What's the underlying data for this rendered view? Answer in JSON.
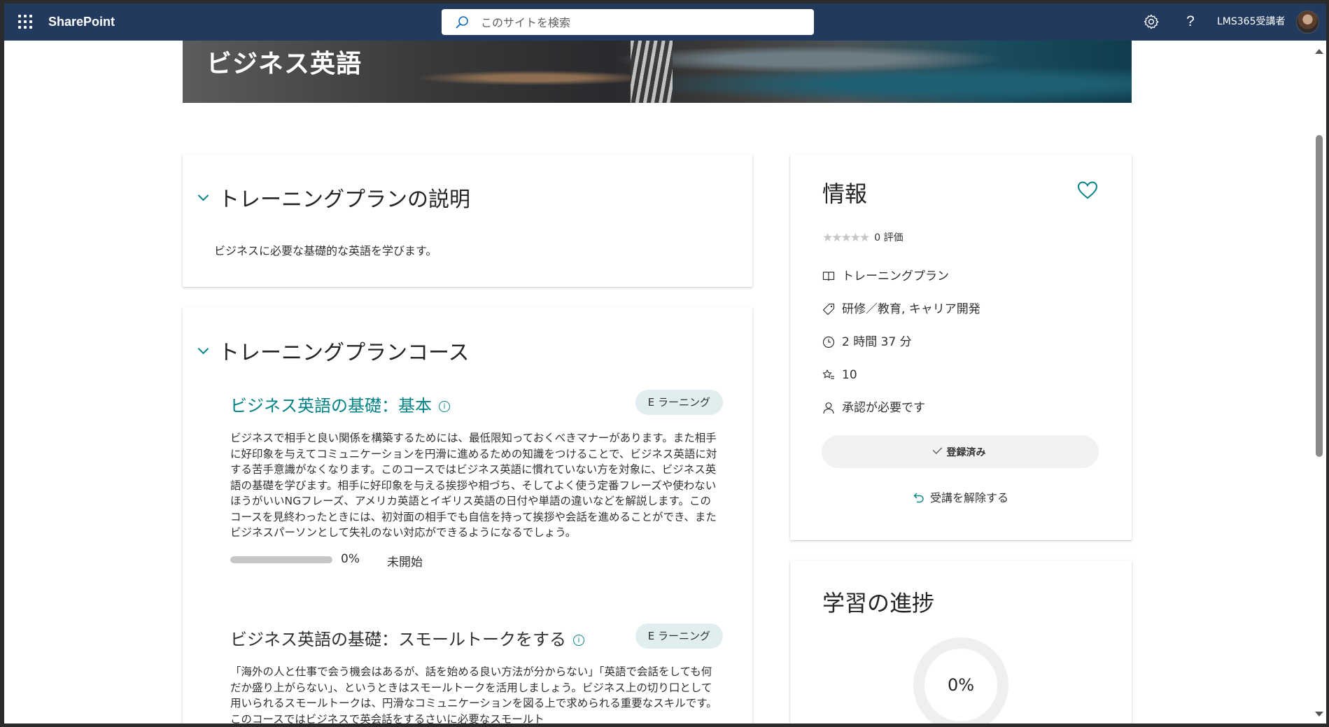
{
  "suitebar": {
    "brand": "SharePoint",
    "search_placeholder": "このサイトを検索",
    "help_label": "?",
    "username": "LMS365受講者"
  },
  "hero": {
    "title": "ビジネス英語"
  },
  "description_section": {
    "heading": "トレーニングプランの説明",
    "text": "ビジネスに必要な基礎的な英語を学びます。"
  },
  "courses_section": {
    "heading": "トレーニングプランコース",
    "courses": [
      {
        "title": "ビジネス英語の基礎：基本",
        "badge": "E ラーニング",
        "body": "ビジネスで相手と良い関係を構築するためには、最低限知っておくべきマナーがあります。また相手に好印象を与えてコミュニケーションを円滑に進めるための知識をつけることで、ビジネス英語に対する苦手意識がなくなります。このコースではビジネス英語に慣れていない方を対象に、ビジネス英語の基礎を学びます。相手に好印象を与える挨拶や相づち、そしてよく使う定番フレーズや使わないほうがいいNGフレーズ、アメリカ英語とイギリス英語の日付や単語の違いなどを解説します。このコースを見終わったときには、初対面の相手でも自信を持って挨拶や会話を進めることができ、またビジネスパーソンとして失礼のない対応ができるようになるでしょう。",
        "progress_pct": "0%",
        "progress_value": 0,
        "status": "未開始"
      },
      {
        "title": "ビジネス英語の基礎：スモールトークをする",
        "badge": "E ラーニング",
        "body": "「海外の人と仕事で会う機会はあるが、話を始める良い方法が分からない」「英語で会話をしても何だか盛り上がらない」、というときはスモールトークを活用しましょう。ビジネス上の切り口として用いられるスモールトークは、円滑なコミュニケーションを図る上で求められる重要なスキルです。このコースではビジネスで英会話をするさいに必要なスモールト"
      }
    ]
  },
  "info_card": {
    "heading": "情報",
    "rating_value": 0,
    "rating_max": 5,
    "rating_label": "0 評価",
    "type": "トレーニングプラン",
    "categories": "研修／教育, キャリア開発",
    "duration": "2 時間 37 分",
    "points": "10",
    "approval": "承認が必要です",
    "enrolled_button": "登録済み",
    "unenroll_link": "受講を解除する"
  },
  "progress_card": {
    "heading": "学習の進捗",
    "percent": "0%",
    "value": 0
  },
  "colors": {
    "suitebar": "#223a5e",
    "accent": "#038387",
    "badge_bg": "#e1eef0"
  }
}
